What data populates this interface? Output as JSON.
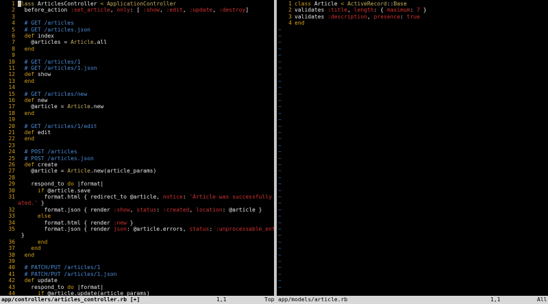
{
  "left": {
    "lines": [
      {
        "n": "1",
        "parts": [
          [
            "k",
            "c"
          ],
          [
            "cls",
            "lass "
          ],
          [
            "t",
            "ArticlesController "
          ],
          [
            "k",
            "< "
          ],
          [
            "cls",
            "ApplicationController"
          ]
        ]
      },
      {
        "n": "2",
        "parts": [
          [
            "t",
            "  before_action "
          ],
          [
            "s",
            ":set_article"
          ],
          [
            "t",
            ", "
          ],
          [
            "s",
            "only"
          ],
          [
            "t",
            ": [ "
          ],
          [
            "s",
            ":show"
          ],
          [
            "t",
            ", "
          ],
          [
            "s",
            ":edit"
          ],
          [
            "t",
            ", "
          ],
          [
            "s",
            ":update"
          ],
          [
            "t",
            ", "
          ],
          [
            "s",
            ":destroy"
          ],
          [
            "t",
            "]"
          ]
        ]
      },
      {
        "n": "3",
        "parts": []
      },
      {
        "n": "4",
        "parts": [
          [
            "c",
            "  # GET /articles"
          ]
        ]
      },
      {
        "n": "5",
        "parts": [
          [
            "c",
            "  # GET /articles.json"
          ]
        ]
      },
      {
        "n": "6",
        "parts": [
          [
            "k",
            "  def "
          ],
          [
            "t",
            "index"
          ]
        ]
      },
      {
        "n": "7",
        "parts": [
          [
            "t",
            "    @articles = "
          ],
          [
            "cls",
            "Article"
          ],
          [
            "t",
            ".all"
          ]
        ]
      },
      {
        "n": "8",
        "parts": [
          [
            "k",
            "  end"
          ]
        ]
      },
      {
        "n": "9",
        "parts": []
      },
      {
        "n": "10",
        "parts": [
          [
            "c",
            "  # GET /articles/1"
          ]
        ]
      },
      {
        "n": "11",
        "parts": [
          [
            "c",
            "  # GET /articles/1.json"
          ]
        ]
      },
      {
        "n": "12",
        "parts": [
          [
            "k",
            "  def "
          ],
          [
            "t",
            "show"
          ]
        ]
      },
      {
        "n": "13",
        "parts": [
          [
            "k",
            "  end"
          ]
        ]
      },
      {
        "n": "14",
        "parts": []
      },
      {
        "n": "15",
        "parts": [
          [
            "c",
            "  # GET /articles/new"
          ]
        ]
      },
      {
        "n": "16",
        "parts": [
          [
            "k",
            "  def "
          ],
          [
            "t",
            "new"
          ]
        ]
      },
      {
        "n": "17",
        "parts": [
          [
            "t",
            "    @article = "
          ],
          [
            "cls",
            "Article"
          ],
          [
            "t",
            ".new"
          ]
        ]
      },
      {
        "n": "18",
        "parts": [
          [
            "k",
            "  end"
          ]
        ]
      },
      {
        "n": "19",
        "parts": []
      },
      {
        "n": "20",
        "parts": [
          [
            "c",
            "  # GET /articles/1/edit"
          ]
        ]
      },
      {
        "n": "21",
        "parts": [
          [
            "k",
            "  def "
          ],
          [
            "t",
            "edit"
          ]
        ]
      },
      {
        "n": "22",
        "parts": [
          [
            "k",
            "  end"
          ]
        ]
      },
      {
        "n": "23",
        "parts": []
      },
      {
        "n": "24",
        "parts": [
          [
            "c",
            "  # POST /articles"
          ]
        ]
      },
      {
        "n": "25",
        "parts": [
          [
            "c",
            "  # POST /articles.json"
          ]
        ]
      },
      {
        "n": "26",
        "parts": [
          [
            "k",
            "  def "
          ],
          [
            "t",
            "create"
          ]
        ]
      },
      {
        "n": "27",
        "parts": [
          [
            "t",
            "    @article = "
          ],
          [
            "cls",
            "Article"
          ],
          [
            "t",
            ".new(article_params)"
          ]
        ]
      },
      {
        "n": "28",
        "parts": []
      },
      {
        "n": "29",
        "parts": [
          [
            "t",
            "    respond_to "
          ],
          [
            "k",
            "do "
          ],
          [
            "t",
            "|format|"
          ]
        ]
      },
      {
        "n": "30",
        "parts": [
          [
            "k",
            "      if "
          ],
          [
            "t",
            "@article.save"
          ]
        ]
      },
      {
        "n": "31",
        "parts": [
          [
            "t",
            "        format.html { redirect_to @article, "
          ],
          [
            "s",
            "notice"
          ],
          [
            "t",
            ": "
          ],
          [
            "s",
            "'Article was successfully cre"
          ]
        ]
      },
      {
        "n": "",
        "parts": [
          [
            "s",
            "ated.'"
          ],
          [
            "t",
            " }"
          ]
        ]
      },
      {
        "n": "32",
        "parts": [
          [
            "t",
            "        format.json { render "
          ],
          [
            "s",
            ":show"
          ],
          [
            "t",
            ", "
          ],
          [
            "s",
            "status"
          ],
          [
            "t",
            ": "
          ],
          [
            "s",
            ":created"
          ],
          [
            "t",
            ", "
          ],
          [
            "s",
            "location"
          ],
          [
            "t",
            ": @article }"
          ]
        ]
      },
      {
        "n": "33",
        "parts": [
          [
            "k",
            "      else"
          ]
        ]
      },
      {
        "n": "34",
        "parts": [
          [
            "t",
            "        format.html { render "
          ],
          [
            "s",
            ":new"
          ],
          [
            "t",
            " }"
          ]
        ]
      },
      {
        "n": "35",
        "parts": [
          [
            "t",
            "        format.json { render "
          ],
          [
            "s",
            "json"
          ],
          [
            "t",
            ": @article.errors, "
          ],
          [
            "s",
            "status"
          ],
          [
            "t",
            ": "
          ],
          [
            "s",
            ":unprocessable_entity"
          ]
        ]
      },
      {
        "n": "",
        "parts": [
          [
            "t",
            " }"
          ]
        ]
      },
      {
        "n": "36",
        "parts": [
          [
            "k",
            "      end"
          ]
        ]
      },
      {
        "n": "37",
        "parts": [
          [
            "k",
            "    end"
          ]
        ]
      },
      {
        "n": "38",
        "parts": [
          [
            "k",
            "  end"
          ]
        ]
      },
      {
        "n": "39",
        "parts": []
      },
      {
        "n": "40",
        "parts": [
          [
            "c",
            "  # PATCH/PUT /articles/1"
          ]
        ]
      },
      {
        "n": "41",
        "parts": [
          [
            "c",
            "  # PATCH/PUT /articles/1.json"
          ]
        ]
      },
      {
        "n": "42",
        "parts": [
          [
            "k",
            "  def "
          ],
          [
            "t",
            "update"
          ]
        ]
      },
      {
        "n": "43",
        "parts": [
          [
            "t",
            "    respond_to "
          ],
          [
            "k",
            "do "
          ],
          [
            "t",
            "|format|"
          ]
        ]
      },
      {
        "n": "44",
        "parts": [
          [
            "k",
            "      if "
          ],
          [
            "t",
            "@article.update(article_params)"
          ]
        ]
      }
    ]
  },
  "right": {
    "lines": [
      {
        "n": "1",
        "parts": [
          [
            "k",
            "class "
          ],
          [
            "t",
            "Article "
          ],
          [
            "k",
            "< "
          ],
          [
            "cls",
            "ActiveRecord"
          ],
          [
            "t",
            "::"
          ],
          [
            "cls",
            "Base"
          ]
        ]
      },
      {
        "n": "2",
        "parts": [
          [
            "t",
            "validates "
          ],
          [
            "s",
            ":title"
          ],
          [
            "t",
            ", "
          ],
          [
            "s",
            "length"
          ],
          [
            "t",
            ": { "
          ],
          [
            "s",
            "maximum"
          ],
          [
            "t",
            ": "
          ],
          [
            "s",
            "7"
          ],
          [
            "t",
            " }"
          ]
        ]
      },
      {
        "n": "3",
        "parts": [
          [
            "t",
            "validates "
          ],
          [
            "s",
            ":description"
          ],
          [
            "t",
            ", "
          ],
          [
            "s",
            "presence"
          ],
          [
            "t",
            ": "
          ],
          [
            "s",
            "true"
          ]
        ]
      },
      {
        "n": "4",
        "parts": [
          [
            "k",
            "end"
          ]
        ]
      }
    ],
    "tilde": "~"
  },
  "status": {
    "left_file": "app/controllers/articles_controller.rb [+]",
    "left_pos": "1,1",
    "left_scroll": "Top",
    "right_file": "app/models/article.rb",
    "right_pos": "1,1",
    "right_scroll": "All"
  }
}
